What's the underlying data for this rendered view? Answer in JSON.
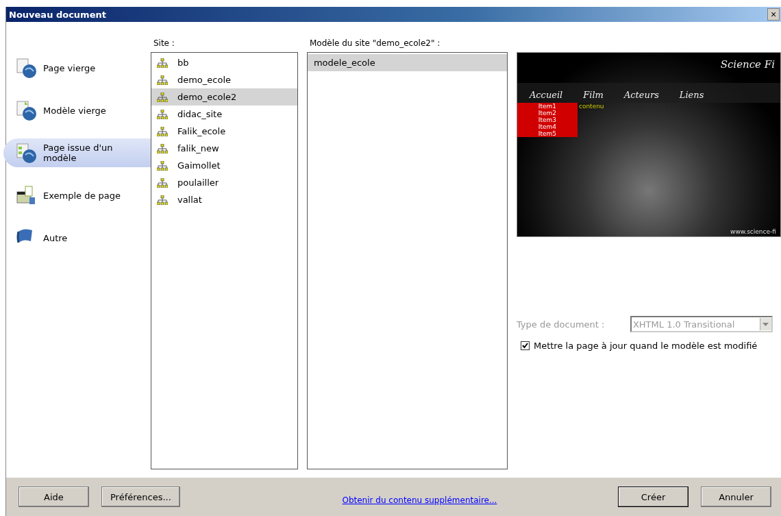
{
  "window": {
    "title": "Nouveau document",
    "close": "×"
  },
  "categories": [
    {
      "label": "Page vierge",
      "kind": "blank-page",
      "selected": false
    },
    {
      "label": "Modèle vierge",
      "kind": "blank-template",
      "selected": false
    },
    {
      "label": "Page issue d'un modèle",
      "kind": "template-page",
      "selected": true
    },
    {
      "label": "Exemple de page",
      "kind": "sample",
      "selected": false
    },
    {
      "label": "Autre",
      "kind": "other",
      "selected": false
    }
  ],
  "site_list": {
    "label": "Site :",
    "items": [
      {
        "label": "bb",
        "selected": false
      },
      {
        "label": "demo_ecole",
        "selected": false
      },
      {
        "label": "demo_ecole2",
        "selected": true
      },
      {
        "label": "didac_site",
        "selected": false
      },
      {
        "label": "Falik_ecole",
        "selected": false
      },
      {
        "label": "falik_new",
        "selected": false
      },
      {
        "label": "Gaimollet",
        "selected": false
      },
      {
        "label": "poulailler",
        "selected": false
      },
      {
        "label": "vallat",
        "selected": false
      }
    ]
  },
  "template_list": {
    "label": "Modèle du site \"demo_ecole2\" :",
    "items": [
      {
        "label": "modele_ecole",
        "selected": true
      }
    ]
  },
  "preview": {
    "title": "Science Fi",
    "nav": [
      "Accueil",
      "Film",
      "Acteurs",
      "Liens"
    ],
    "menu_items": [
      "Item1",
      "Item2",
      "Item3",
      "Item4",
      "Item5"
    ],
    "content": "contenu",
    "footer": "www.science-fi"
  },
  "document_type": {
    "label": "Type de document :",
    "value": "XHTML 1.0 Transitional",
    "disabled": true
  },
  "update_option": {
    "label": "Mettre la page à jour quand le modèle est modifié",
    "checked": true
  },
  "footer": {
    "buttons_left": [
      "Aide",
      "Préférences..."
    ],
    "link": "Obtenir du contenu supplémentaire...",
    "buttons_right": [
      "Créer",
      "Annuler"
    ]
  }
}
